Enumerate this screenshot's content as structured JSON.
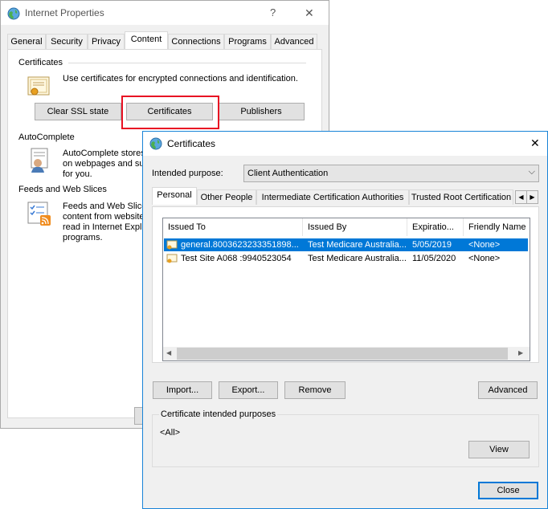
{
  "ip": {
    "title": "Internet Properties",
    "help": "?",
    "close": "✕",
    "tabs": [
      "General",
      "Security",
      "Privacy",
      "Content",
      "Connections",
      "Programs",
      "Advanced"
    ],
    "certificates_group": "Certificates",
    "certificates_text": "Use certificates for encrypted connections and identification.",
    "clear_ssl": "Clear SSL state",
    "certificates_btn": "Certificates",
    "publishers_btn": "Publishers",
    "autocomplete_group": "AutoComplete",
    "autocomplete_text": [
      "AutoComplete stores",
      "on webpages and sug",
      "for you."
    ],
    "feeds_group": "Feeds and Web Slices",
    "feeds_text": [
      "Feeds and Web Slices",
      "content from website",
      "read in Internet Exple",
      "programs."
    ]
  },
  "cert": {
    "title": "Certificates",
    "close": "✕",
    "purpose_label": "Intended purpose:",
    "purpose_value": "Client Authentication",
    "tabs": [
      "Personal",
      "Other People",
      "Intermediate Certification Authorities",
      "Trusted Root Certification"
    ],
    "columns": [
      "Issued To",
      "Issued By",
      "Expiratio...",
      "Friendly Name"
    ],
    "rows": [
      {
        "issued_to": "general.8003623233351898...",
        "issued_by": "Test Medicare Australia...",
        "expiration": "5/05/2019",
        "friendly": "<None>"
      },
      {
        "issued_to": "Test Site A068 :9940523054",
        "issued_by": "Test Medicare Australia...",
        "expiration": "11/05/2020",
        "friendly": "<None>"
      }
    ],
    "import": "Import...",
    "export": "Export...",
    "remove": "Remove",
    "advanced": "Advanced",
    "purposes_group": "Certificate intended purposes",
    "purposes_value": "<All>",
    "view": "View",
    "close_btn": "Close"
  },
  "colors": {
    "highlight": "#0078d7",
    "red_box": "#e81123",
    "window_border": "#1883d7"
  }
}
